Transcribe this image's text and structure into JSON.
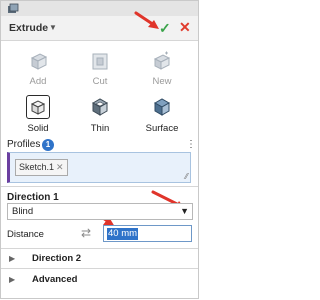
{
  "header": {
    "title": "Extrude",
    "confirm_icon": "checkmark-icon",
    "cancel_icon": "close-icon"
  },
  "tools_row1": [
    {
      "label": "Add",
      "icon": "add-body-icon",
      "enabled": false
    },
    {
      "label": "Cut",
      "icon": "cut-body-icon",
      "enabled": false
    },
    {
      "label": "New",
      "icon": "new-body-icon",
      "enabled": false
    }
  ],
  "tools_row2": [
    {
      "label": "Solid",
      "icon": "solid-icon",
      "selected": true
    },
    {
      "label": "Thin",
      "icon": "thin-icon",
      "selected": false
    },
    {
      "label": "Surface",
      "icon": "surface-icon",
      "selected": false
    }
  ],
  "profiles": {
    "label": "Profiles",
    "count": "1",
    "items": [
      "Sketch.1"
    ]
  },
  "direction1": {
    "title": "Direction 1",
    "mode": "Blind",
    "distance_label": "Distance",
    "distance_value": "40 mm"
  },
  "sections": [
    {
      "label": "Direction 2"
    },
    {
      "label": "Advanced"
    }
  ],
  "colors": {
    "ok": "#3aa34a",
    "cancel": "#e03b2c",
    "accent": "#2f73c9",
    "arrow": "#e0342a"
  }
}
